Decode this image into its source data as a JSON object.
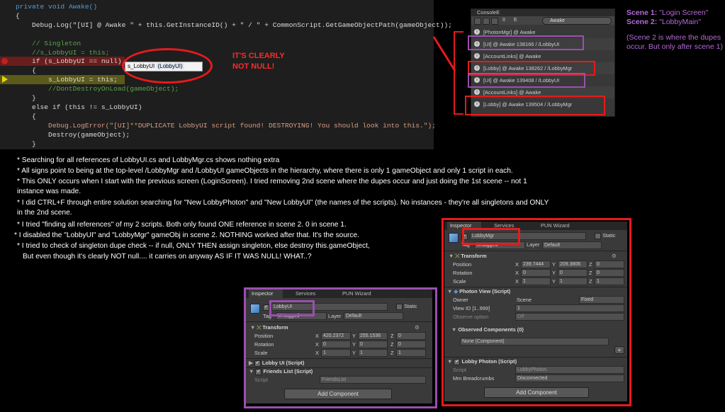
{
  "code": {
    "lines": [
      {
        "t": "private void Awake()"
      },
      {
        "t": "{"
      },
      {
        "t": "    Debug.Log(\"[UI] @ Awake \" + this.GetInstanceID() + \" / \" + CommonScript.GetGameObjectPath(gameObject));"
      },
      {
        "t": ""
      },
      {
        "t": "    // Singleton"
      },
      {
        "t": "    //s_LobbyUI = this;"
      },
      {
        "t": "    if (s_LobbyUI == null)"
      },
      {
        "t": "    {"
      },
      {
        "t": "        s_LobbyUI = this;"
      },
      {
        "t": "        //DontDestroyOnLoad(gameObject);"
      },
      {
        "t": "    }"
      },
      {
        "t": "    else if (this != s_LobbyUI)"
      },
      {
        "t": "    {"
      },
      {
        "t": "        Debug.LogError(\"[UI]**DUPLICATE LobbyUI script found! DESTROYING! You should look into this.\");"
      },
      {
        "t": "        Destroy(gameObject);"
      },
      {
        "t": "    }"
      }
    ],
    "tooltip_name": "s_LobbyUI",
    "tooltip_value": "(LobbyUI)",
    "annotation_line1": "IT'S CLEARLY",
    "annotation_line2": "NOT NULL!"
  },
  "notes": [
    "* Searching for all references of LobbyUI.cs and LobbyMgr.cs shows nothing extra",
    "* All signs point to being at the top-level /LobbyMgr and /LobbyUI gameObjects in the hierarchy, where there is only 1 gameObject and only 1 script in each.",
    "* This ONLY occurs when I start with the previous screen (LoginScreen). I tried removing 2nd scene where the dupes occur and just doing the 1st scene -- not 1",
    "instance was made.",
    "* I did CTRL+F through entire solution searching for \"New LobbyPhoton\" and \"New LobbyUI\" (the names of the scripts). No instances - they're all singletons and ONLY",
    "in the 2nd scene.",
    "* I tried \"finding all references\" of my 2 scripts. Both only found ONE reference in scene 2. 0 in scene 1.",
    "* I disabled the \"LobbyUI\" and \"LobbyMgr\" gameObj in scene 2. NOTHING worked after that. It's the source.",
    "* I tried to check of singleton dupe check -- if null, ONLY THEN assign singleton, else destroy this.gameObject,",
    "But even though it's clearly NOT null.... it carries on anyway AS IF IT WAS NULL! WHAT..?"
  ],
  "console": {
    "title": "ConsoleE",
    "search": "Awake",
    "rows": [
      "[PhotonMgr] @ Awake",
      "[UI] @ Awake 138166 / /LobbyUI",
      "[AccountLinks] @ Awake",
      "[Lobby] @ Awake 138262 / /LobbyMgr",
      "[UI] @ Awake 139408 / /LobbyUI",
      "[AccountLinks] @ Awake",
      "[Lobby] @ Awake 139504 / /LobbyMgr"
    ],
    "toolbar_buttons": [
      "II",
      "E"
    ]
  },
  "scenes": {
    "scene1_label": "Scene 1:",
    "scene1_value": "\"Login Screen\"",
    "scene2_label": "Scene 2:",
    "scene2_value": "\"LobbyMain\"",
    "note": "(Scene 2 is where the dupes occur. But only after scene 1)"
  },
  "inspector_ui": {
    "tabs": [
      "Inspector",
      "Services",
      "PUN Wizard"
    ],
    "name": "LobbyUI",
    "static_label": "Static",
    "tag_label": "Tag",
    "tag_value": "Untagged",
    "layer_label": "Layer",
    "layer_value": "Default",
    "transform_title": "Transform",
    "position_label": "Position",
    "rotation_label": "Rotation",
    "scale_label": "Scale",
    "pos": [
      "420.2372",
      "255.1536",
      "0"
    ],
    "rot": [
      "0",
      "0",
      "0"
    ],
    "scale": [
      "1",
      "1",
      "1"
    ],
    "comp1": "Lobby UI (Script)",
    "comp2": "Friends List (Script)",
    "script_label": "Script",
    "script_value": "FriendsList",
    "add_component": "Add Component"
  },
  "inspector_mgr": {
    "tabs": [
      "Inspector",
      "Services",
      "PUN Wizard"
    ],
    "name": "LobbyMgr",
    "static_label": "Static",
    "tag_label": "Tag",
    "tag_value": "Untagged",
    "layer_label": "Layer",
    "layer_value": "Default",
    "transform_title": "Transform",
    "position_label": "Position",
    "rotation_label": "Rotation",
    "scale_label": "Scale",
    "pos": [
      "239.7444",
      "209.3806",
      "0"
    ],
    "rot": [
      "0",
      "0",
      "0"
    ],
    "scale": [
      "1",
      "1",
      "1"
    ],
    "photon_view": "Photon View (Script)",
    "owner_label": "Owner",
    "owner_value": "Scene",
    "owner_option": "Fixed",
    "viewid_label": "View ID [1..999]",
    "viewid_value": "1",
    "observe_label": "Observe option",
    "observe_value": "Off",
    "observed_title": "Observed Components (0)",
    "observed_value": "None (Component)",
    "lobby_photon": "Lobby Photon (Script)",
    "script_label": "Script",
    "script_value": "LobbyPhoton",
    "breadcrumbs_label": "Mm Breadcrumbs",
    "breadcrumbs_value": "Disconnected",
    "add_component": "Add Component"
  },
  "colors": {
    "red": "#e81a1a",
    "purple": "#9b4fb0",
    "accent": "#b56ad8"
  }
}
